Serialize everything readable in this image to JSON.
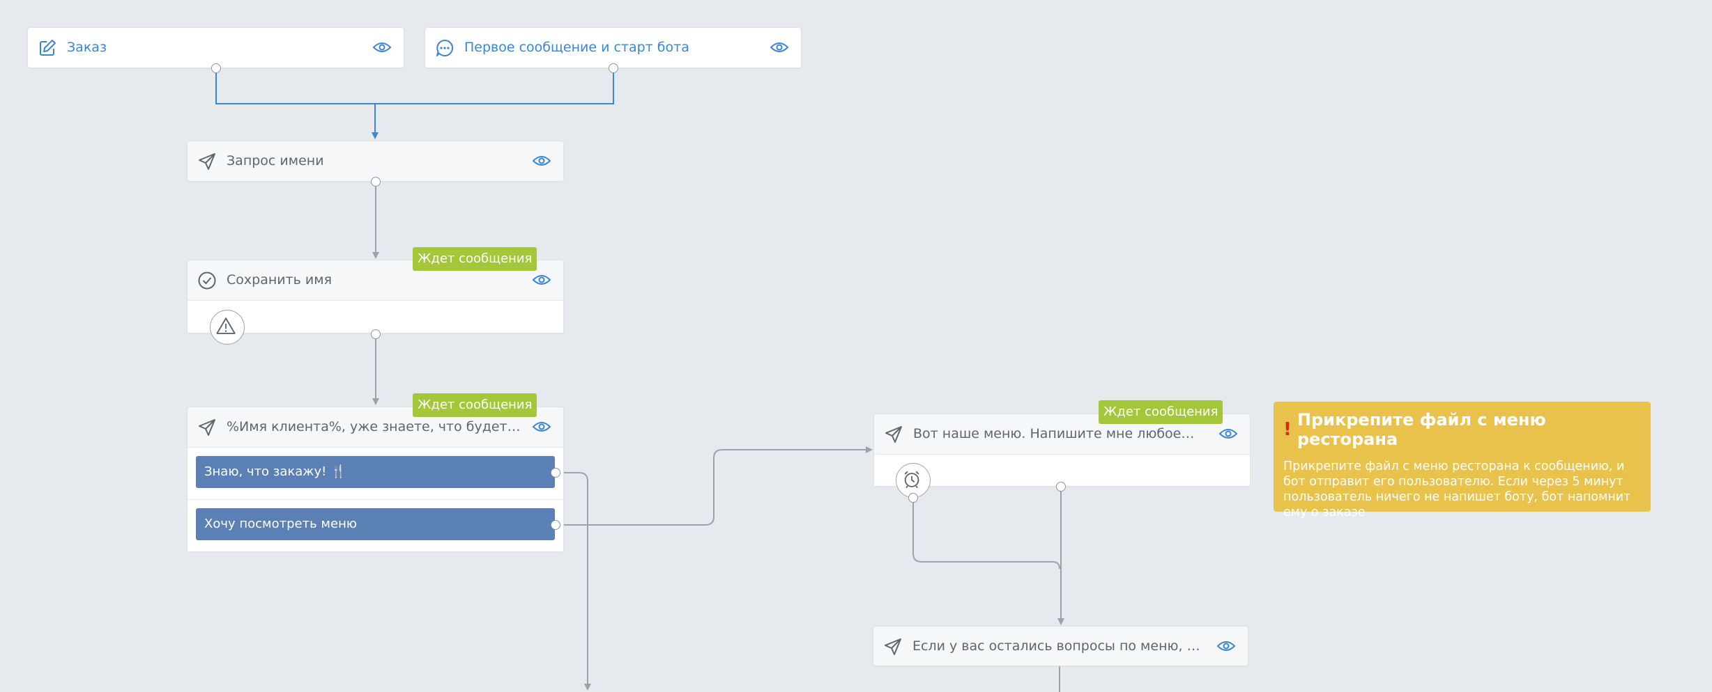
{
  "nodes": {
    "order": {
      "title": "Заказ"
    },
    "first_message": {
      "title": "Первое сообщение и старт бота"
    },
    "ask_name": {
      "title": "Запрос имени"
    },
    "save_name": {
      "title": "Сохранить имя",
      "badge": "Ждет сообщения"
    },
    "client_question": {
      "title": "%Имя клиента%, уже знаете, что будете…",
      "badge": "Ждет сообщения",
      "buttons": [
        {
          "label": "Знаю, что закажу! 🍴"
        },
        {
          "label": "Хочу посмотреть меню"
        }
      ]
    },
    "menu": {
      "title": "Вот наше меню. Напишите мне любое…",
      "badge": "Ждет сообщения"
    },
    "questions": {
      "title": "Если у вас остались вопросы по меню, вы…"
    }
  },
  "note": {
    "title": "Прикрепите файл с меню ресторана",
    "text": "Прикрепите файл с меню ресторана к сообщению, и бот отправит его пользователю. Если через 5 минут пользователь ничего не напишет боту, бот напомнит ему о заказе"
  },
  "colors": {
    "canvas": "#e6eaee",
    "accent_blue": "#3b86d4",
    "button_blue": "#5b80b5",
    "badge_green": "#a4c639",
    "note_yellow": "#e8c24a",
    "wire_gray": "#9aa3ab"
  },
  "icons": {
    "order": "edit-icon",
    "first_message": "chat-icon",
    "ask_name": "send-icon",
    "save_name": "check-circle-icon",
    "warning": "warning-icon",
    "timer": "alarm-clock-icon"
  }
}
